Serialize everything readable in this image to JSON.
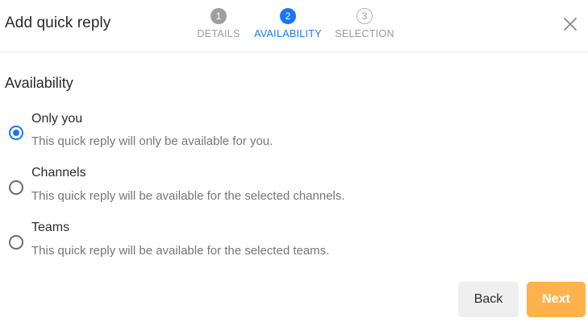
{
  "dialog": {
    "title": "Add quick reply"
  },
  "stepper": {
    "steps": [
      {
        "number": "1",
        "label": "DETAILS",
        "state": "done"
      },
      {
        "number": "2",
        "label": "AVAILABILITY",
        "state": "active"
      },
      {
        "number": "3",
        "label": "SELECTION",
        "state": "upcoming"
      }
    ]
  },
  "close_icon": "close-icon",
  "availability": {
    "title": "Availability",
    "selected": "only_you",
    "options": [
      {
        "id": "only_you",
        "label": "Only you",
        "description": "This quick reply will only be available for you."
      },
      {
        "id": "channels",
        "label": "Channels",
        "description": "This quick reply will be available for the selected channels."
      },
      {
        "id": "teams",
        "label": "Teams",
        "description": "This quick reply will be available for the selected teams."
      }
    ]
  },
  "footer": {
    "back_label": "Back",
    "next_label": "Next"
  },
  "colors": {
    "accent": "#1976f5",
    "next_button": "#ffb14c",
    "back_button": "#efefef"
  }
}
